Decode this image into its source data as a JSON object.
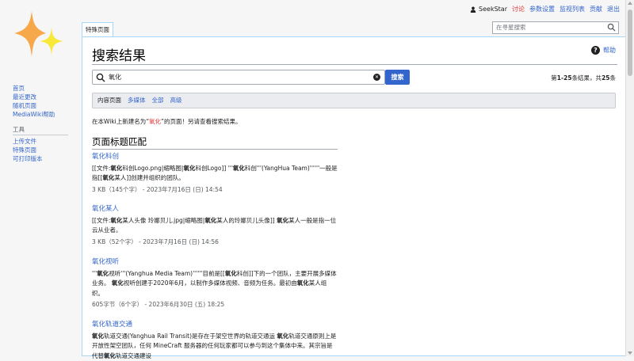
{
  "personal": {
    "username": "SeekStar",
    "talk": "讨论",
    "preferences": "参数设置",
    "watchlist": "监视列表",
    "contributions": "贡献",
    "logout": "退出"
  },
  "sidebar": {
    "nav": [
      "首页",
      "最近更改",
      "随机页面",
      "MediaWiki帮助"
    ],
    "tools_heading": "工具",
    "tools": [
      "上传文件",
      "特殊页面",
      "可打印版本"
    ]
  },
  "tab": {
    "label": "特殊页面"
  },
  "top_search": {
    "placeholder": "在寻星搜索"
  },
  "page": {
    "title": "搜索结果",
    "help": "帮助"
  },
  "search": {
    "value": "氧化",
    "button": "搜索",
    "count_prefix": "第",
    "count_range": "1-25",
    "count_mid": "条结果，共",
    "count_total": "25",
    "count_suffix": "条"
  },
  "profiles": [
    "内容页面",
    "多媒体",
    "全部",
    "高级"
  ],
  "create_note": {
    "prefix": "在本Wiki上新建名为“",
    "term": "氧化",
    "suffix": "”的页面！另请查看搜索结果。"
  },
  "section_heading": "页面标题匹配",
  "results": [
    {
      "title": "氧化科创",
      "snippet": [
        {
          "t": "[[文件:"
        },
        {
          "t": "氧化",
          "b": true
        },
        {
          "t": "科创Logo.png|缩略图|"
        },
        {
          "t": "氧化",
          "b": true
        },
        {
          "t": "科创Logo]] '''"
        },
        {
          "t": "氧化",
          "b": true
        },
        {
          "t": "科创'''(YangHua Team)''''''一般是指[["
        },
        {
          "t": "氧化",
          "b": true
        },
        {
          "t": "某人]]创建并组织的团队。"
        }
      ],
      "meta": "3 KB（145个字） - 2023年7月16日 (日) 14:54"
    },
    {
      "title": "氧化某人",
      "snippet": [
        {
          "t": "[[文件:"
        },
        {
          "t": "氧化",
          "b": true
        },
        {
          "t": "某人头像 玲娜贝儿.jpg|缩略图|"
        },
        {
          "t": "氧化",
          "b": true
        },
        {
          "t": "某人的玲娜贝儿头像]] "
        },
        {
          "t": "氧化",
          "b": true
        },
        {
          "t": "某人一般是指一位云从业者。"
        }
      ],
      "meta": "3 KB（52个字） - 2023年7月16日 (日) 14:56"
    },
    {
      "title": "氧化视听",
      "snippet": [
        {
          "t": "'''"
        },
        {
          "t": "氧化",
          "b": true
        },
        {
          "t": "视听'''(Yanghua Media Team)''''''目前是[["
        },
        {
          "t": "氧化",
          "b": true
        },
        {
          "t": "科创]]下的一个团队，主要开展多媒体业务。 "
        },
        {
          "t": "氧化",
          "b": true
        },
        {
          "t": "视听创建于2020年6月，以制作多媒体视频、音频为任务。最初由"
        },
        {
          "t": "氧化",
          "b": true
        },
        {
          "t": "某人组织。"
        }
      ],
      "meta": "605字节（6个字） - 2023年6月30日 (五) 18:25"
    },
    {
      "title": "氧化轨道交通",
      "snippet": [
        {
          "t": "氧化",
          "b": true
        },
        {
          "t": "轨道交通(Yanghua Rail Transit)是存在于架空世界的轨道交通运 "
        },
        {
          "t": "氧化",
          "b": true
        },
        {
          "t": "轨道交通原则上是开放性架空团队，任何 MineCraft 服务器的任何玩家都可以参与到这个集体中来。其宗旨是代替"
        },
        {
          "t": "氧化",
          "b": true
        },
        {
          "t": "轨道交通建设"
        }
      ],
      "meta": ""
    }
  ],
  "colors": {
    "link": "#3366cc",
    "red_link": "#dd3333",
    "button": "#3366cc",
    "logo_orange": "#f7a84a",
    "logo_yellow": "#f7e83a"
  }
}
